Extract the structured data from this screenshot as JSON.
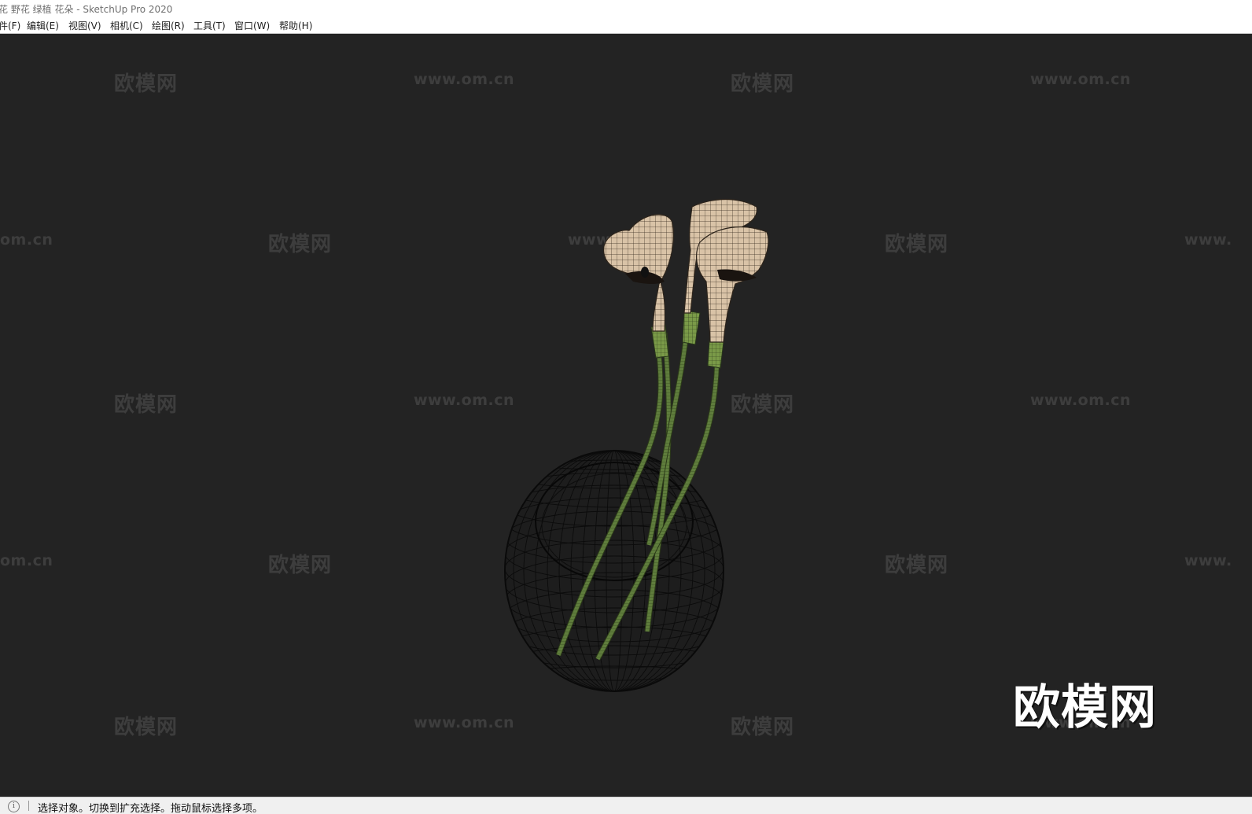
{
  "window": {
    "title": "花 野花 绿植 花朵 - SketchUp Pro 2020"
  },
  "menu": {
    "items": [
      {
        "label": "件(F)"
      },
      {
        "label": "编辑(E)"
      },
      {
        "label": "视图(V)"
      },
      {
        "label": "相机(C)"
      },
      {
        "label": "绘图(R)"
      },
      {
        "label": "工具(T)"
      },
      {
        "label": "窗口(W)"
      },
      {
        "label": "帮助(H)"
      }
    ]
  },
  "viewport": {
    "watermark_cn": "欧模网",
    "watermark_url": "www.om.cn",
    "watermark_url_partial_left": "om.cn",
    "watermark_url_partial_right": "www.",
    "brand_logo_text": "欧模网",
    "model_description_icon": "calla-lily-vase-wireframe"
  },
  "status": {
    "info_icon": "info-icon",
    "info_icon_glyph": "i",
    "message": "选择对象。切换到扩充选择。拖动鼠标选择多项。"
  },
  "colors": {
    "viewport_bg": "#232323",
    "petal": "#d9c3a7",
    "stem": "#5c7a3a",
    "vase_wire": "#0e0e0e"
  }
}
